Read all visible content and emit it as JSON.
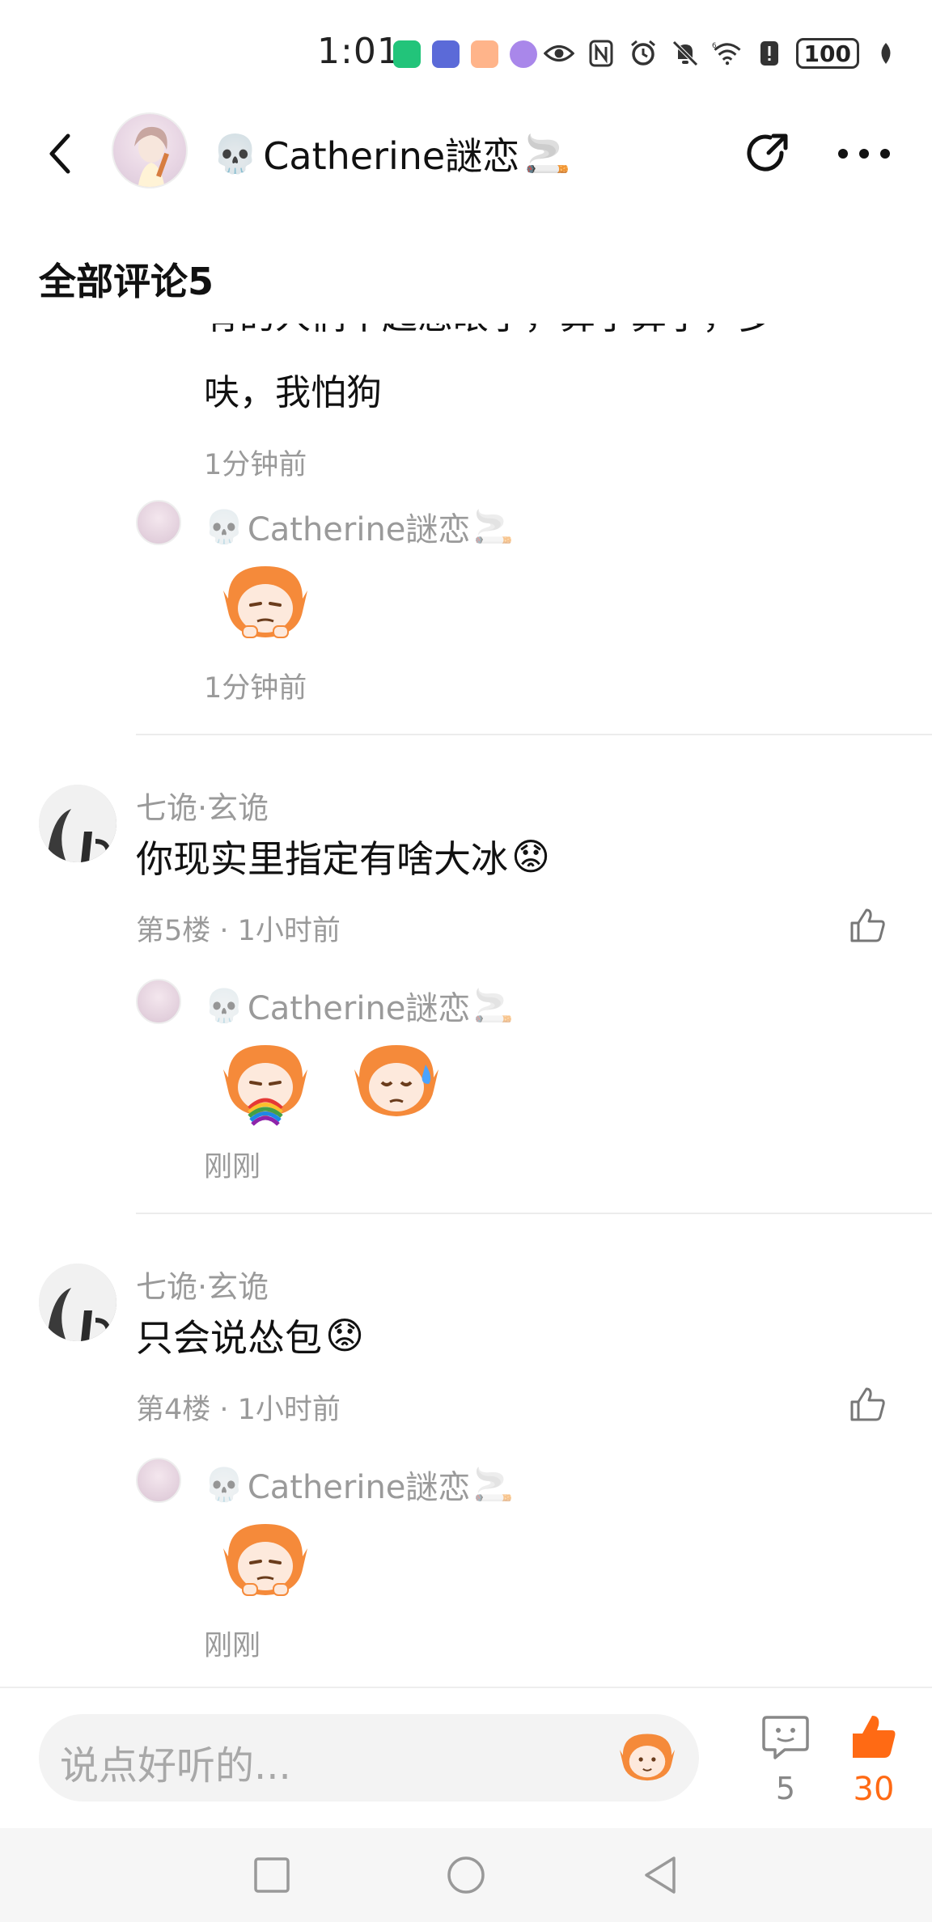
{
  "status_bar": {
    "time": "1:01",
    "battery": "100",
    "icons": [
      "hourglass-app-icon",
      "app-icon",
      "heart-app-icon",
      "planet-app-icon",
      "eye-icon",
      "nfc-icon",
      "alarm-icon",
      "mute-icon",
      "wifi-icon",
      "alert-icon",
      "battery-icon",
      "leaf-icon"
    ]
  },
  "header": {
    "skull_emoji": "💀",
    "title": "Catherine謎恋",
    "cigarette_emoji": "🚬"
  },
  "section": {
    "title": "全部评论5"
  },
  "thread_top": {
    "reply_text_partial": "有的人们不起恶眼了，算了算了，多",
    "reply_text_line2": "呋，我怕狗",
    "reply_time": "1分钟前",
    "sub_reply": {
      "skull": "💀",
      "name": "Catherine謎恋",
      "cig": "🚬",
      "time": "1分钟前"
    }
  },
  "comments": [
    {
      "user": "七诡·玄诡",
      "text": "你现实里指定有啥大冰",
      "emoji": "😟",
      "meta": "第5楼 · 1小时前",
      "reply": {
        "skull": "💀",
        "name": "Catherine謎恋",
        "cig": "🚬",
        "time": "刚刚"
      }
    },
    {
      "user": "七诡·玄诡",
      "text": "只会说怂包",
      "emoji": "😟",
      "meta": "第4楼 · 1小时前",
      "reply": {
        "skull": "💀",
        "name": "Catherine謎恋",
        "cig": "🚬",
        "time": "刚刚"
      }
    }
  ],
  "bottom_bar": {
    "input_placeholder": "说点好听的...",
    "comment_count": "5",
    "like_count": "30"
  },
  "colors": {
    "accent": "#ff6a14",
    "muted": "#9a9a9a"
  }
}
